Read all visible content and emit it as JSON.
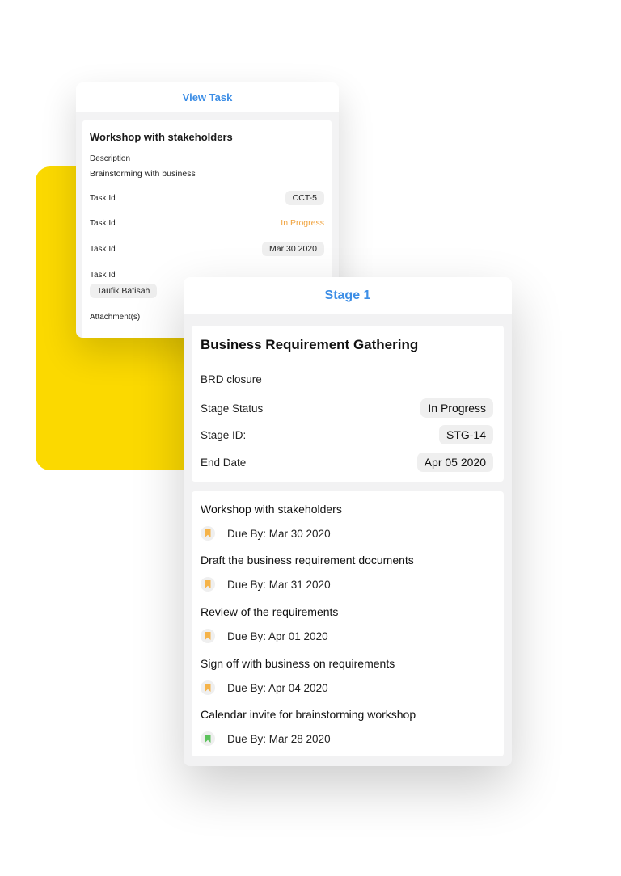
{
  "view_task": {
    "header": "View Task",
    "title": "Workshop with stakeholders",
    "description_label": "Description",
    "description": "Brainstorming with business",
    "rows": [
      {
        "label": "Task Id",
        "value": "CCT-5"
      },
      {
        "label": "Task Id",
        "value": "In Progress"
      },
      {
        "label": "Task Id",
        "value": "Mar 30 2020"
      }
    ],
    "assignee_label": "Task Id",
    "assignee": "Taufik Batisah",
    "attachments_label": "Attachment(s)"
  },
  "stage": {
    "header": "Stage 1",
    "title": "Business Requirement Gathering",
    "subtitle": "BRD closure",
    "rows": [
      {
        "label": "Stage Status",
        "value": "In Progress"
      },
      {
        "label": "Stage ID:",
        "value": "STG-14"
      },
      {
        "label": "End Date",
        "value": "Apr 05 2020"
      }
    ],
    "tasks": [
      {
        "title": "Workshop with stakeholders",
        "due": "Due By: Mar 30 2020",
        "bookmark_color": "#f5b349"
      },
      {
        "title": "Draft the business requirement documents",
        "due": "Due By: Mar 31 2020",
        "bookmark_color": "#f5b349"
      },
      {
        "title": "Review of the requirements",
        "due": "Due By: Apr 01 2020",
        "bookmark_color": "#f5b349"
      },
      {
        "title": "Sign off with business on requirements",
        "due": "Due By: Apr 04 2020",
        "bookmark_color": "#f5b349"
      },
      {
        "title": "Calendar invite for brainstorming workshop",
        "due": "Due By: Mar 28 2020",
        "bookmark_color": "#5cc25c"
      }
    ]
  },
  "colors": {
    "accent": "#3d8ee6",
    "yellow": "#fbd900",
    "in_progress": "#f0a23c"
  }
}
